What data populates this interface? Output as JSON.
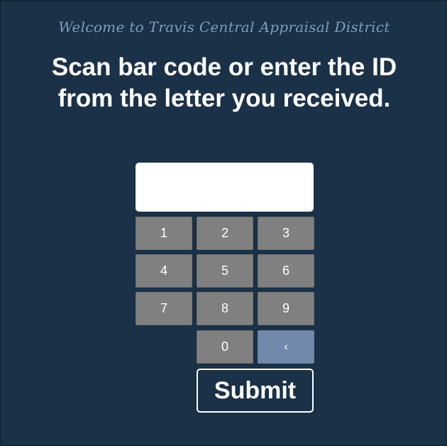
{
  "welcome_text": "Welcome to Travis Central Appraisal District",
  "heading": "Scan bar code or enter the ID from the letter you received.",
  "id_input": {
    "value": "",
    "placeholder": ""
  },
  "keypad": {
    "keys": [
      "1",
      "2",
      "3",
      "4",
      "5",
      "6",
      "7",
      "8",
      "9",
      "0"
    ],
    "backspace_label": "‹"
  },
  "submit_label": "Submit",
  "colors": {
    "background": "#1a3147",
    "welcome_text": "#7f9bbd",
    "key_background": "#808080",
    "backspace_background": "#7189aa"
  }
}
